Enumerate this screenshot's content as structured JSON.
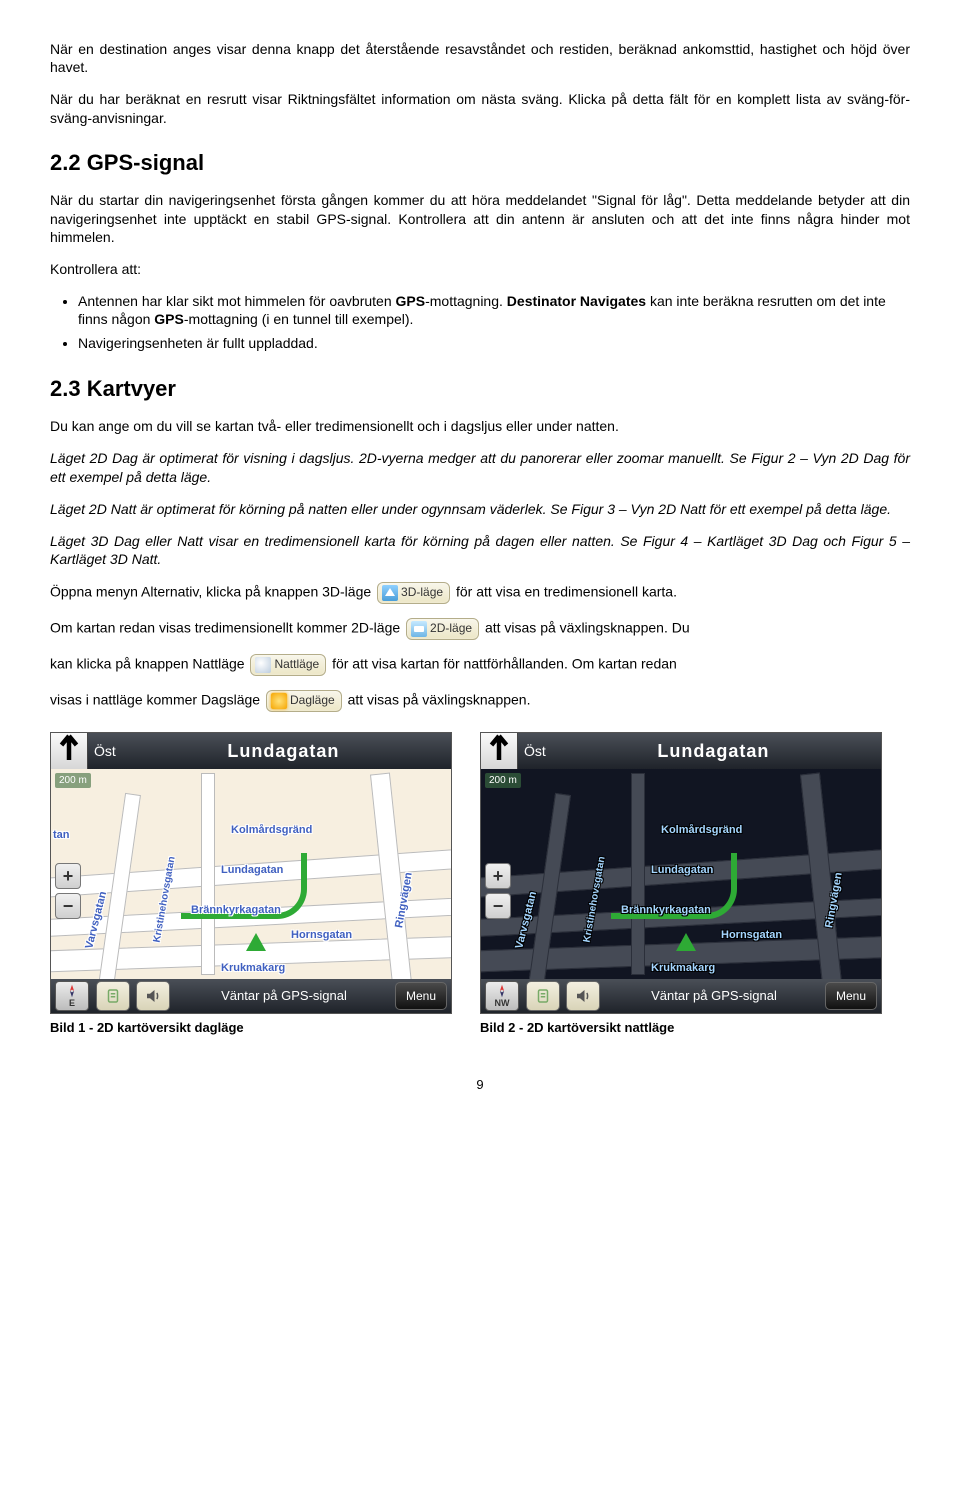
{
  "para1": "När en destination anges visar denna knapp det återstående resavståndet och restiden, beräknad ankomsttid, hastighet och höjd över havet.",
  "para2": "När du har beräknat en resrutt visar Riktningsfältet information om nästa sväng. Klicka på detta fält för en komplett lista av sväng-för-sväng-anvisningar.",
  "sec22_title": "2.2    GPS-signal",
  "sec22_p1": "När du startar din navigeringsenhet första gången kommer du att höra meddelandet \"Signal för låg\". Detta meddelande betyder att din navigeringsenhet inte upptäckt en stabil GPS-signal. Kontrollera att din antenn är ansluten och att det inte finns några hinder mot himmelen.",
  "sec22_p2": "Kontrollera att:",
  "sec22_li1_a": "Antennen har klar sikt mot himmelen för oavbruten ",
  "sec22_li1_b": "GPS",
  "sec22_li1_c": "-mottagning. ",
  "sec22_li1_d": "Destinator Navigates",
  "sec22_li1_e": " kan inte beräkna resrutten om det inte finns någon ",
  "sec22_li1_f": "GPS",
  "sec22_li1_g": "-mottagning (i en tunnel till exempel).",
  "sec22_li2": "Navigeringsenheten är fullt uppladdad.",
  "sec23_title": "2.3    Kartvyer",
  "sec23_p1": "Du kan ange om du vill se kartan två- eller tredimensionellt och i dagsljus eller under natten.",
  "sec23_p2": "Läget 2D Dag är optimerat för visning i dagsljus. 2D-vyerna medger att du panorerar eller zoomar manuellt. Se Figur 2 – Vyn 2D Dag för ett exempel på detta läge.",
  "sec23_p3": "Läget 2D Natt är optimerat för körning på natten eller under ogynnsam väderlek. Se Figur 3 – Vyn 2D Natt för ett exempel på detta läge.",
  "sec23_p4": "Läget 3D Dag eller Natt visar en tredimensionell karta för körning på dagen eller natten. Se Figur 4 – Kartläget 3D Dag och Figur 5 – Kartläget 3D Natt.",
  "sec23_p5a": "Öppna menyn Alternativ, klicka på knappen 3D-läge ",
  "sec23_p5b": " för att visa en tredimensionell karta.",
  "sec23_p6a": "Om kartan redan visas tredimensionellt kommer 2D-läge ",
  "sec23_p6b": " att visas på växlingsknappen. Du",
  "sec23_p7a": "kan klicka på knappen Nattläge ",
  "sec23_p7b": " för att visa kartan för nattförhållanden. Om kartan redan",
  "sec23_p8a": "visas i nattläge kommer Dagsläge ",
  "sec23_p8b": " att visas på växlingsknappen.",
  "btn_3d": "3D-läge",
  "btn_2d": "2D-läge",
  "btn_night": "Nattläge",
  "btn_day": "Dagläge",
  "map": {
    "direction": "Öst",
    "street": "Lundagatan",
    "scale": "200 m",
    "compass_day": "E",
    "compass_night": "NW",
    "status": "Väntar på GPS-signal",
    "menu": "Menu",
    "labels": {
      "l1": "Kolmårdsgränd",
      "l2": "Lundagatan",
      "l3": "Brännkyrkagatan",
      "l4": "Hornsgatan",
      "l5": "Krukmakarg",
      "l6": "Varvsgatan",
      "l7": "Kristinehovsgatan",
      "l8": "Ringvägen",
      "l9": "tan"
    }
  },
  "caption1": "Bild 1 - 2D kartöversikt dagläge",
  "caption2": "Bild 2 - 2D kartöversikt nattläge",
  "page": "9"
}
